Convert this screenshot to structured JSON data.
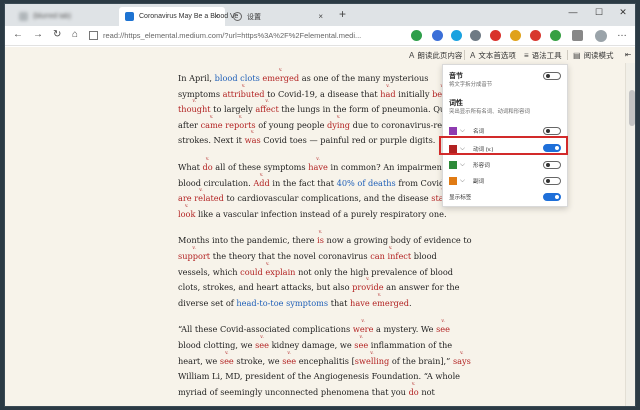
{
  "tabs": [
    {
      "title": "(blurred tab)"
    },
    {
      "title": "Coronavirus May Be a Blood Ve",
      "close": "×"
    },
    {
      "title": "设置",
      "close": "×"
    }
  ],
  "new_tab": "+",
  "window_controls": {
    "minimize": "—",
    "maximize": "☐",
    "close": "✕"
  },
  "nav": {
    "back": "←",
    "forward": "→",
    "refresh": "↻",
    "home": "⌂"
  },
  "address": {
    "url": "read://https_elemental.medium.com/?url=https%3A%2F%2Felemental.medi..."
  },
  "more_icon": "…",
  "reader_toolbar": {
    "read_aloud": "朗读此页内容",
    "text_prefs": "文本首选项",
    "grammar_tools": "语法工具",
    "reading_mode": "阅读模式"
  },
  "grammar_panel": {
    "syllables_title": "音节",
    "syllables_desc": "将文字拆分成音节",
    "syllables_on": false,
    "pos_title": "词性",
    "pos_desc": "突出显示所有名词、动词和形容词",
    "pos": [
      {
        "label": "名词",
        "color": "#8e3bb0",
        "on": false
      },
      {
        "label": "动词 (v.)",
        "color": "#b22222",
        "on": true
      },
      {
        "label": "形容词",
        "color": "#2e8b3a",
        "on": false
      },
      {
        "label": "副词",
        "color": "#e07b14",
        "on": false
      }
    ],
    "show_labels": "显示标签",
    "show_labels_on": true
  },
  "article": {
    "paragraphs": [
      {
        "lines": [
          [
            {
              "t": "In April, ",
              "k": "w"
            },
            {
              "t": "blood clots",
              "k": "link"
            },
            {
              "t": " ",
              "k": "w"
            },
            {
              "t": "emerged",
              "k": "verb"
            },
            {
              "t": " as one of the many mysterious",
              "k": "w"
            }
          ],
          [
            {
              "t": "symptoms ",
              "k": "w"
            },
            {
              "t": "attributed",
              "k": "verb"
            },
            {
              "t": " to Covid-19, a disease that ",
              "k": "w"
            },
            {
              "t": "had",
              "k": "verb"
            },
            {
              "t": " initially ",
              "k": "w"
            },
            {
              "t": "been",
              "k": "verb"
            }
          ],
          [
            {
              "t": "thought",
              "k": "verb"
            },
            {
              "t": " to largely ",
              "k": "w"
            },
            {
              "t": "affect",
              "k": "verb"
            },
            {
              "t": " the lungs in the form of pneumonia. Quic",
              "k": "w"
            }
          ],
          [
            {
              "t": "after ",
              "k": "w"
            },
            {
              "t": "came",
              "k": "verb"
            },
            {
              "t": " ",
              "k": "w"
            },
            {
              "t": "reports",
              "k": "verb"
            },
            {
              "t": " of young people ",
              "k": "w"
            },
            {
              "t": "dying",
              "k": "verb"
            },
            {
              "t": " due to coronavirus-rela",
              "k": "w"
            }
          ],
          [
            {
              "t": "strokes. Next it ",
              "k": "w"
            },
            {
              "t": "was",
              "k": "verb"
            },
            {
              "t": " Covid toes — painful red or purple digits.",
              "k": "w"
            }
          ]
        ]
      },
      {
        "lines": [
          [
            {
              "t": "What ",
              "k": "w"
            },
            {
              "t": "do",
              "k": "verb"
            },
            {
              "t": " all of these symptoms ",
              "k": "w"
            },
            {
              "t": "have",
              "k": "verb"
            },
            {
              "t": " in common? An impairment",
              "k": "w"
            }
          ],
          [
            {
              "t": "blood circulation. ",
              "k": "w"
            },
            {
              "t": "Add",
              "k": "verb"
            },
            {
              "t": " in the fact that ",
              "k": "w"
            },
            {
              "t": "40% of deaths",
              "k": "link"
            },
            {
              "t": " from Covid-",
              "k": "w"
            }
          ],
          [
            {
              "t": "are related",
              "k": "verb"
            },
            {
              "t": " to cardiovascular complications, and the disease ",
              "k": "w"
            },
            {
              "t": "starts",
              "k": "verb"
            }
          ],
          [
            {
              "t": "look",
              "k": "verb"
            },
            {
              "t": " like a vascular infection instead of a purely respiratory one.",
              "k": "w"
            }
          ]
        ]
      },
      {
        "lines": [
          [
            {
              "t": "Months into the pandemic, there ",
              "k": "w"
            },
            {
              "t": "is",
              "k": "verb"
            },
            {
              "t": " now a growing body of evidence to",
              "k": "w"
            }
          ],
          [
            {
              "t": "support",
              "k": "verb"
            },
            {
              "t": " the theory that the novel coronavirus ",
              "k": "w"
            },
            {
              "t": "can infect",
              "k": "verb"
            },
            {
              "t": " blood",
              "k": "w"
            }
          ],
          [
            {
              "t": "vessels, which ",
              "k": "w"
            },
            {
              "t": "could explain",
              "k": "verb"
            },
            {
              "t": " not only the high prevalence of blood",
              "k": "w"
            }
          ],
          [
            {
              "t": "clots, strokes, and heart attacks, but also ",
              "k": "w"
            },
            {
              "t": "provide",
              "k": "verb"
            },
            {
              "t": " an answer for the",
              "k": "w"
            }
          ],
          [
            {
              "t": "diverse set of ",
              "k": "w"
            },
            {
              "t": "head-to-toe symptoms",
              "k": "link"
            },
            {
              "t": " that ",
              "k": "w"
            },
            {
              "t": "have emerged",
              "k": "verb"
            },
            {
              "t": ".",
              "k": "w"
            }
          ]
        ]
      },
      {
        "lines": [
          [
            {
              "t": "“All these Covid-associated complications ",
              "k": "w"
            },
            {
              "t": "were",
              "k": "verb"
            },
            {
              "t": " a mystery. We ",
              "k": "w"
            },
            {
              "t": "see",
              "k": "verb"
            }
          ],
          [
            {
              "t": "blood clotting, we ",
              "k": "w"
            },
            {
              "t": "see",
              "k": "verb"
            },
            {
              "t": " kidney damage, we ",
              "k": "w"
            },
            {
              "t": "see",
              "k": "verb"
            },
            {
              "t": " inflammation of the",
              "k": "w"
            }
          ],
          [
            {
              "t": "heart, we ",
              "k": "w"
            },
            {
              "t": "see",
              "k": "verb"
            },
            {
              "t": " stroke, we ",
              "k": "w"
            },
            {
              "t": "see",
              "k": "verb"
            },
            {
              "t": " encephalitis [",
              "k": "w"
            },
            {
              "t": "swelling",
              "k": "verb"
            },
            {
              "t": " of the brain],” ",
              "k": "w"
            },
            {
              "t": "says",
              "k": "verb"
            }
          ],
          [
            {
              "t": "William Li, MD, president of the Angiogenesis Foundation. “A whole",
              "k": "w"
            }
          ],
          [
            {
              "t": "myriad of seemingly unconnected phenomena that you ",
              "k": "w"
            },
            {
              "t": "do",
              "k": "verb"
            },
            {
              "t": " not",
              "k": "w"
            }
          ]
        ]
      }
    ]
  }
}
